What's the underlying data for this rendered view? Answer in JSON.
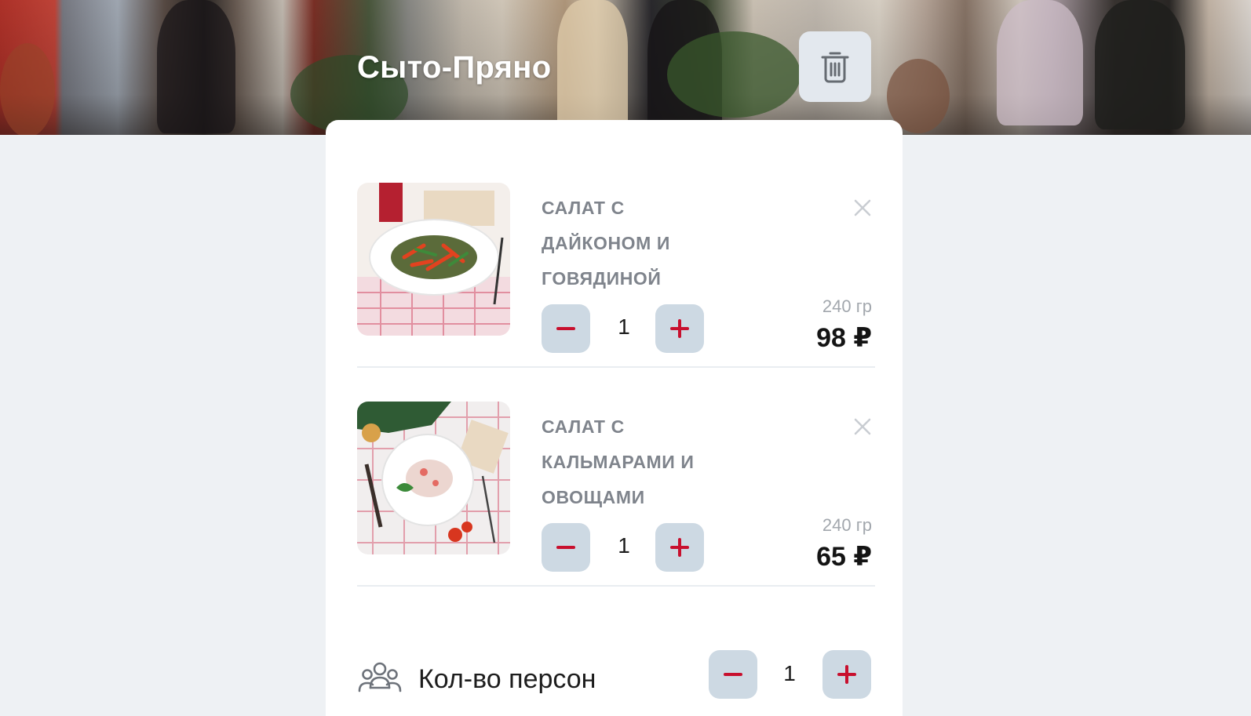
{
  "restaurant": {
    "title": "Сыто-Пряно"
  },
  "cart": {
    "items": [
      {
        "name": "Салат с дайконом и говядиной",
        "quantity": "1",
        "weight": "240 гр",
        "price": "98 ₽"
      },
      {
        "name": "Салат с кальмарами и овощами",
        "quantity": "1",
        "weight": "240 гр",
        "price": "65 ₽"
      }
    ],
    "persons": {
      "label": "Кол-во персон",
      "quantity": "1"
    }
  },
  "icons": {
    "clear_cart": "trash-icon",
    "remove_item": "close-icon",
    "decrease": "minus-icon",
    "increase": "plus-icon",
    "persons": "people-icon"
  },
  "colors": {
    "accent": "#c8102e",
    "qty_button_bg": "#cdd9e3",
    "page_bg": "#eef1f4",
    "item_name": "#7f848c"
  }
}
